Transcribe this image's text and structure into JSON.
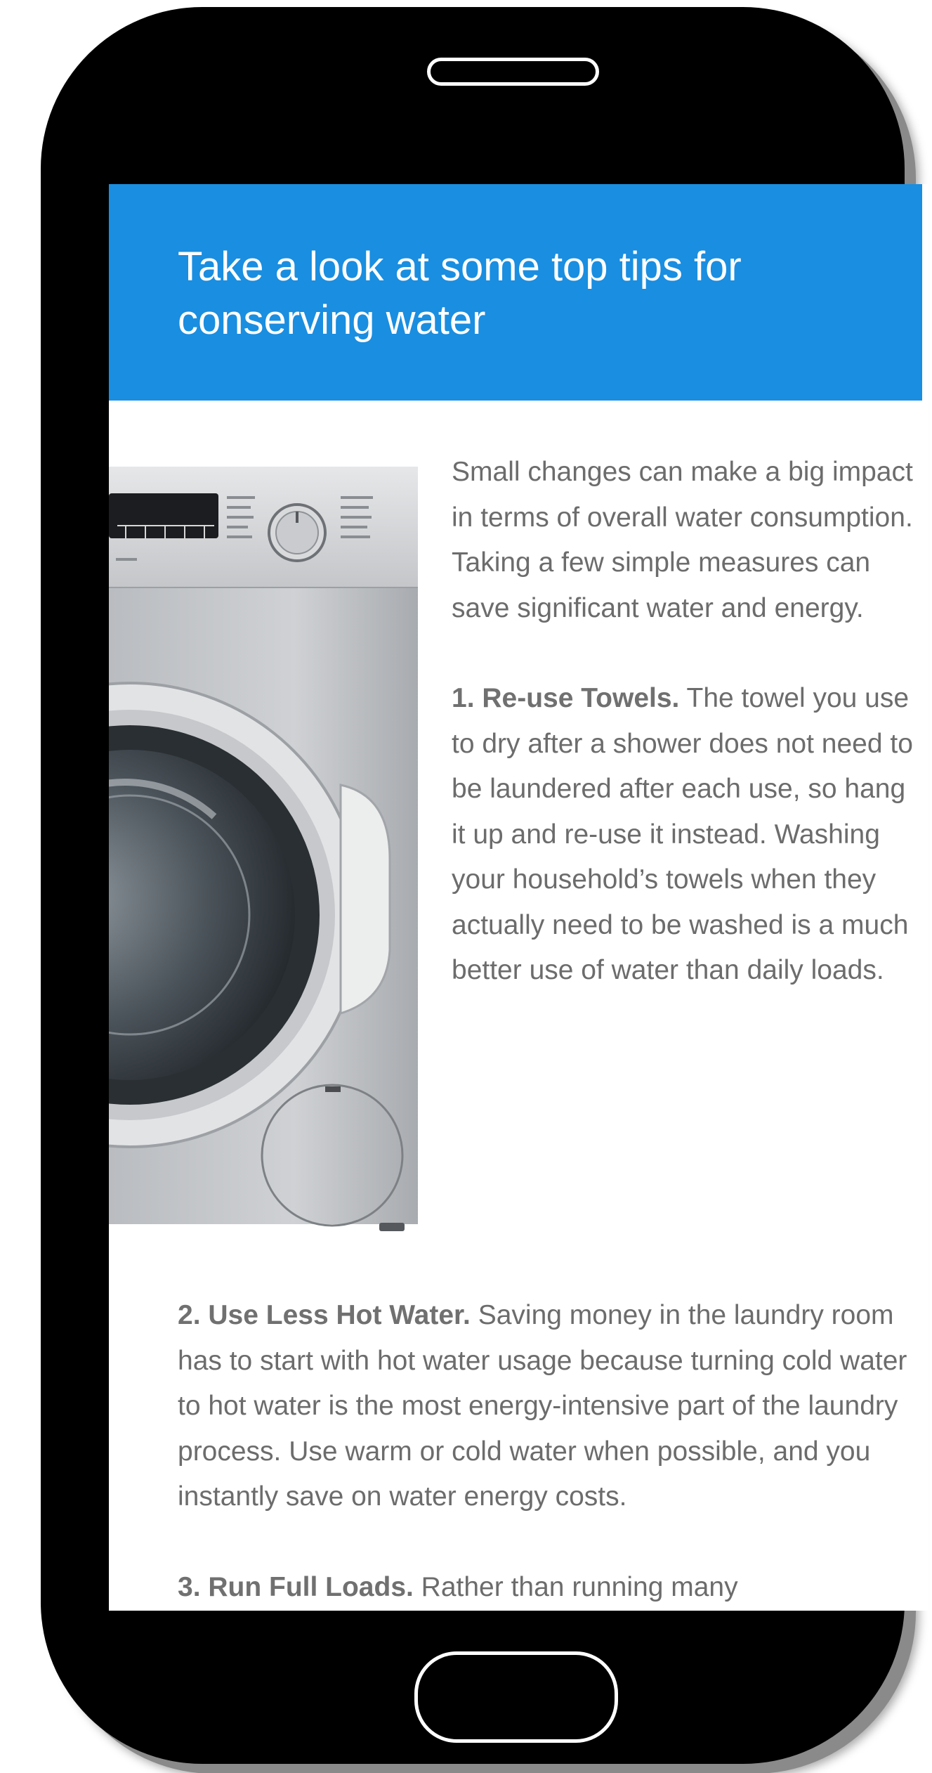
{
  "header": {
    "title": "Take a look at some top tips for conserving water"
  },
  "intro": {
    "text": "Small changes can make a big impact in terms of overall water consumption. Taking a few simple measures can save significant water and energy."
  },
  "tips": [
    {
      "title": "1. Re-use Towels.",
      "body": " The towel you use to dry after a shower does not need to be laundered after each use, so hang it up and re-use it instead. Washing your household’s towels when they actually need to be washed is a much better use of water than daily loads."
    },
    {
      "title": "2. Use Less Hot Water.",
      "body": " Saving money in the laundry room has to start with hot water usage because turning cold water to hot water is the most energy-intensive part of the laundry process. Use warm or cold water when possible, and you instantly save on water energy costs."
    },
    {
      "title": "3. Run Full Loads.",
      "body": " Rather than running many"
    }
  ],
  "colors": {
    "header_bg": "#1a8ee0",
    "header_text": "#ffffff",
    "body_text": "#6c6c6c",
    "phone_body": "#000000"
  },
  "icons": {
    "speaker": "speaker-slot-icon",
    "home": "home-button"
  },
  "image": {
    "subject": "washing-machine"
  }
}
